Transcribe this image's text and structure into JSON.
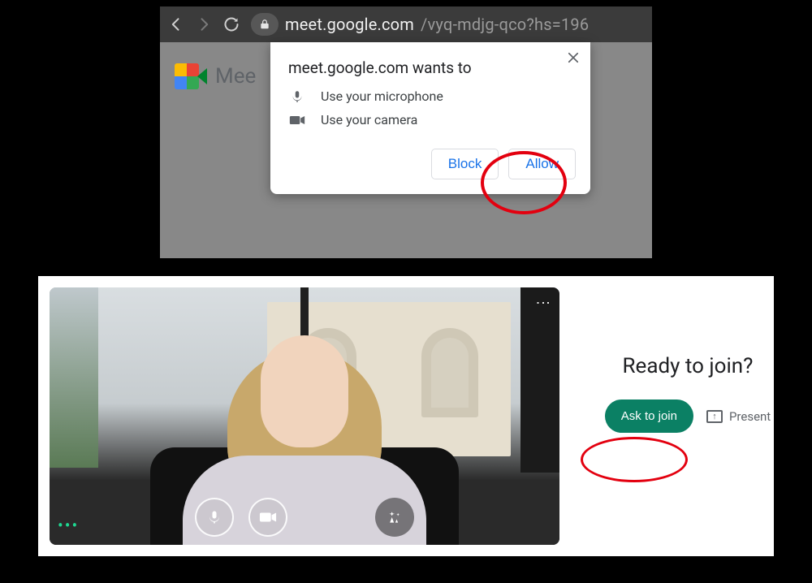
{
  "browser": {
    "url_host": "meet.google.com",
    "url_path": "/vyq-mdjg-qco?hs=196"
  },
  "meet": {
    "brand_partial": "Mee"
  },
  "permission": {
    "title": "meet.google.com wants to",
    "items": [
      {
        "icon": "microphone-icon",
        "label": "Use your microphone"
      },
      {
        "icon": "camera-icon",
        "label": "Use your camera"
      }
    ],
    "block_label": "Block",
    "allow_label": "Allow"
  },
  "join": {
    "heading": "Ready to join?",
    "ask_label": "Ask to join",
    "present_label": "Present"
  },
  "colors": {
    "accent_blue": "#1a73e8",
    "accent_green": "#0b8064",
    "annotation_red": "#e3000f"
  }
}
